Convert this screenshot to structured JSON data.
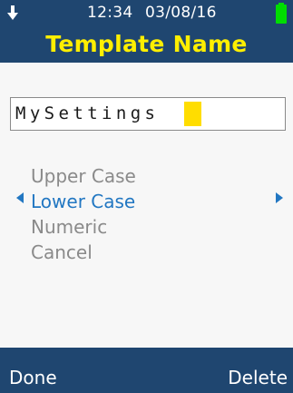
{
  "status_bar": {
    "time": "12:34",
    "date": "03/08/16",
    "download_icon": "down-arrow-icon",
    "battery_icon": "battery-icon",
    "battery_color": "#00dd00"
  },
  "header": {
    "title": "Template Name",
    "title_color": "#ffef00",
    "background": "#1f4670"
  },
  "entry": {
    "value": "MySettings",
    "cursor_color": "#ffdd00"
  },
  "options": {
    "items": [
      {
        "label": "Upper Case",
        "selected": false
      },
      {
        "label": "Lower Case",
        "selected": true
      },
      {
        "label": "Numeric",
        "selected": false
      },
      {
        "label": "Cancel",
        "selected": false
      }
    ],
    "selected_color": "#2277c2",
    "left_indicator_icon": "left-triangle-icon",
    "right_indicator_icon": "right-triangle-icon"
  },
  "footer": {
    "left_label": "Done",
    "right_label": "Delete"
  }
}
